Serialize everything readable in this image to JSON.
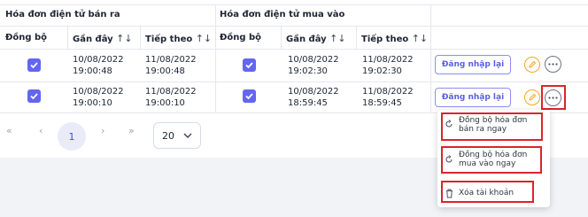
{
  "table": {
    "group_sales": "Hóa đơn điện tử bán ra",
    "group_purchase": "Hóa đơn điện tử mua vào",
    "columns": {
      "sync": "Đồng bộ",
      "recent": "Gần đây",
      "next": "Tiếp theo",
      "sort_glyph": "↑↓"
    },
    "rows": [
      {
        "sales_sync": true,
        "sales_recent": [
          "10/08/2022",
          "19:00:48"
        ],
        "sales_next": [
          "11/08/2022",
          "19:00:48"
        ],
        "purchase_sync": true,
        "purchase_recent": [
          "10/08/2022",
          "19:02:30"
        ],
        "purchase_next": [
          "11/08/2022",
          "19:02:30"
        ],
        "login_label": "Đăng nhập lại"
      },
      {
        "sales_sync": true,
        "sales_recent": [
          "10/08/2022",
          "19:00:10"
        ],
        "sales_next": [
          "11/08/2022",
          "19:00:10"
        ],
        "purchase_sync": true,
        "purchase_recent": [
          "10/08/2022",
          "18:59:45"
        ],
        "purchase_next": [
          "11/08/2022",
          "18:59:45"
        ],
        "login_label": "Đăng nhập lại"
      }
    ]
  },
  "pagination": {
    "first": "«",
    "prev": "‹",
    "current_page": "1",
    "next": "›",
    "last": "»",
    "page_size": "20"
  },
  "menu": {
    "items": [
      {
        "label_line1": "Đồng bộ hóa đơn",
        "label_line2": "bán ra ngay",
        "icon": "refresh-icon"
      },
      {
        "label_line1": "Đồng bộ hóa đơn",
        "label_line2": "mua vào ngay",
        "icon": "refresh-icon"
      },
      {
        "label": "Xóa tài khoản",
        "icon": "trash-icon"
      }
    ]
  },
  "colors": {
    "accent": "#6366f1",
    "edit": "#f5a623",
    "highlight": "#d9252b"
  }
}
